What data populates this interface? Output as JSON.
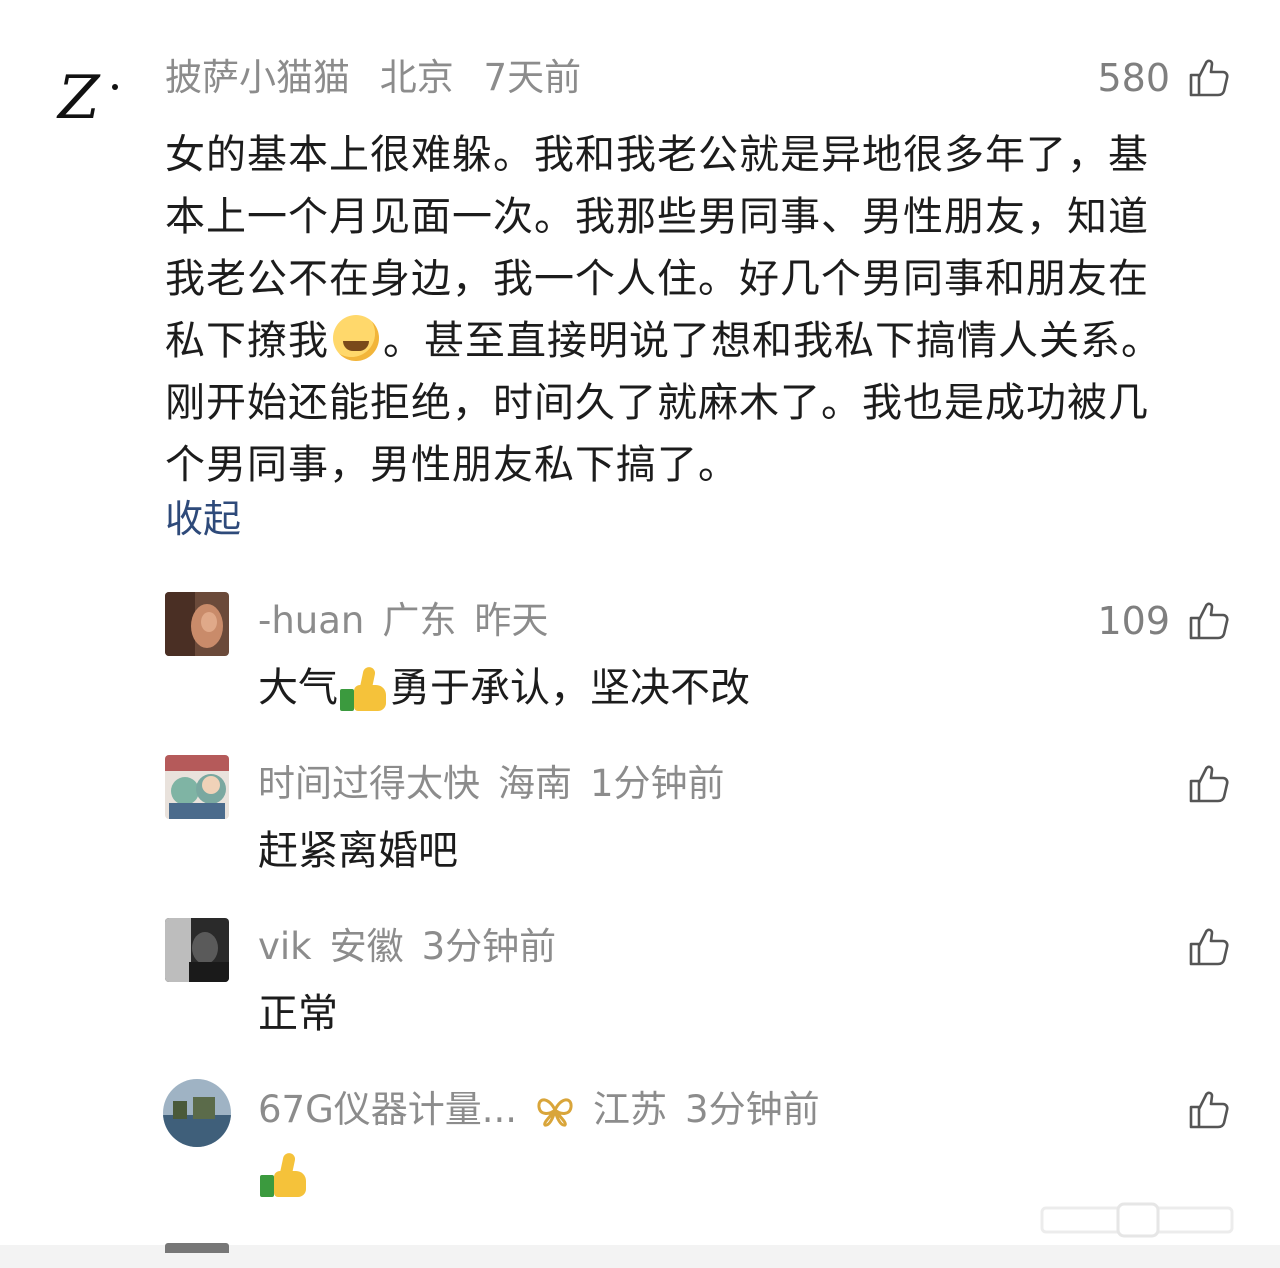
{
  "main_comment": {
    "avatar_text": "Z",
    "username": "披萨小猫猫",
    "location": "北京",
    "time": "7天前",
    "likes": "580",
    "lines": [
      {
        "text": "女的基本上很难躲。我和我老公就是异地很多年了，基"
      },
      {
        "text": "本上一个月见面一次。我那些男同事、男性朋友，知道"
      },
      {
        "text": "我老公不在身边，我一个人住。好几个男同事和朋友在"
      },
      {
        "before": "私下撩我",
        "after": "。甚至直接明说了想和我私下搞情人关系。"
      },
      {
        "text": "刚开始还能拒绝，时间久了就麻木了。我也是成功被几"
      },
      {
        "text": "个男同事，男性朋友私下搞了。"
      }
    ],
    "collapse_label": "收起"
  },
  "replies": [
    {
      "username": "-huan",
      "location": "广东",
      "time": "昨天",
      "likes": "109",
      "text_before": "大气",
      "text_after": "勇于承认，坚决不改"
    },
    {
      "username": "时间过得太快",
      "location": "海南",
      "time": "1分钟前",
      "likes": "",
      "text": "赶紧离婚吧"
    },
    {
      "username": "vik",
      "location": "安徽",
      "time": "3分钟前",
      "likes": "",
      "text": "正常"
    },
    {
      "username": "67G仪器计量...",
      "location": "江苏",
      "time": "3分钟前",
      "likes": "",
      "text": ""
    }
  ],
  "icons": {
    "like": "thumbs-up-outline-icon",
    "emoji_cry": "crying-laughing-emoji",
    "emoji_thumb": "thumbs-up-emoji",
    "badge": "butterfly-badge-icon"
  },
  "colors": {
    "meta": "#8c8c8c",
    "text": "#1c1c1c",
    "link": "#2e4a7a",
    "thumb_emoji": "#f5c23a"
  }
}
